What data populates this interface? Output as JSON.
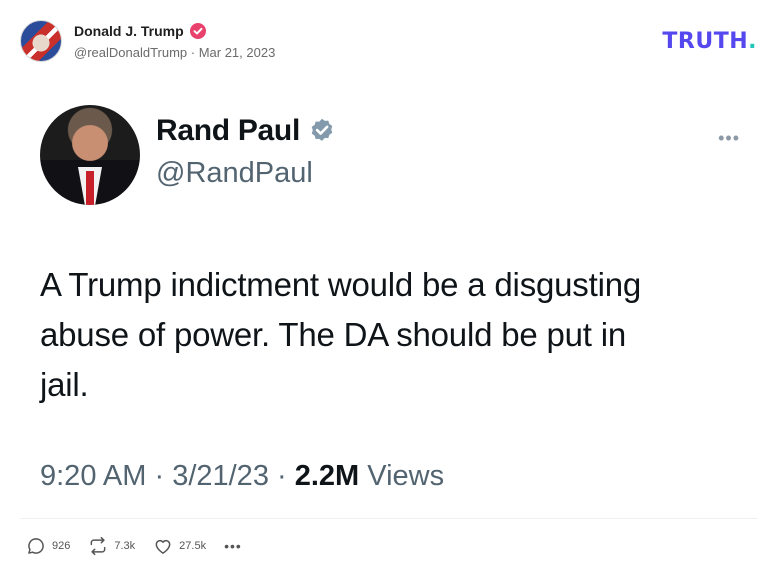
{
  "truth_post": {
    "author_name": "Donald J. Trump",
    "author_meta": "@realDonaldTrump · Mar 21, 2023",
    "logo_text": "TRUTH",
    "logo_dot": ".",
    "brand_color": "#5448ee",
    "verified_color": "#e8416b"
  },
  "tweet": {
    "name": "Rand Paul",
    "handle": "@RandPaul",
    "more_label": "•••",
    "text": "A Trump indictment would be a disgusting abuse of power. The DA should be put in jail.",
    "time": "9:20 AM",
    "sep1": " · ",
    "date": "3/21/23",
    "sep2": " · ",
    "views_count": "2.2M",
    "views_label": " Views",
    "verified_color": "#829aab"
  },
  "actions": {
    "replies": "926",
    "retruths": "7.3k",
    "likes": "27.5k",
    "more_label": "•••",
    "icons": [
      "reply-icon",
      "retruth-icon",
      "heart-icon",
      "more-icon"
    ]
  }
}
